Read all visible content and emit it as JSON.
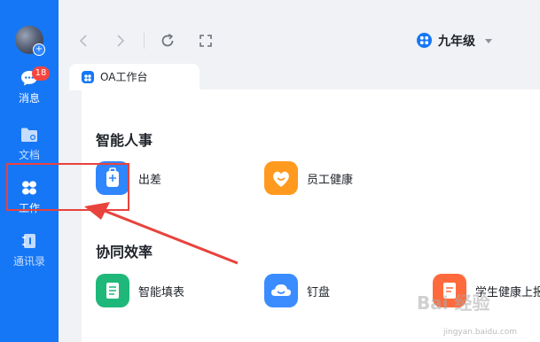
{
  "sidebar": {
    "items": [
      {
        "label": "消息",
        "badge": "18"
      },
      {
        "label": "文档"
      },
      {
        "label": "工作"
      },
      {
        "label": "通讯录"
      }
    ]
  },
  "header": {
    "org_name": "九年级",
    "tab_label": "OA工作台"
  },
  "sections": [
    {
      "title": "智能人事",
      "apps": [
        {
          "label": "出差",
          "color": "#2f86ff"
        },
        {
          "label": "员工健康",
          "color": "#ff9a1f"
        }
      ]
    },
    {
      "title": "协同效率",
      "apps": [
        {
          "label": "智能填表",
          "color": "#1fb87a"
        },
        {
          "label": "钉盘",
          "color": "#3a8cff"
        },
        {
          "label": "学生健康上报",
          "color": "#ff6a3d"
        }
      ]
    }
  ],
  "colors": {
    "sidebar": "#1677f6",
    "annotation": "#e8433d"
  },
  "watermark": {
    "text": "Bai 经验",
    "url": "jingyan.baidu.com"
  }
}
